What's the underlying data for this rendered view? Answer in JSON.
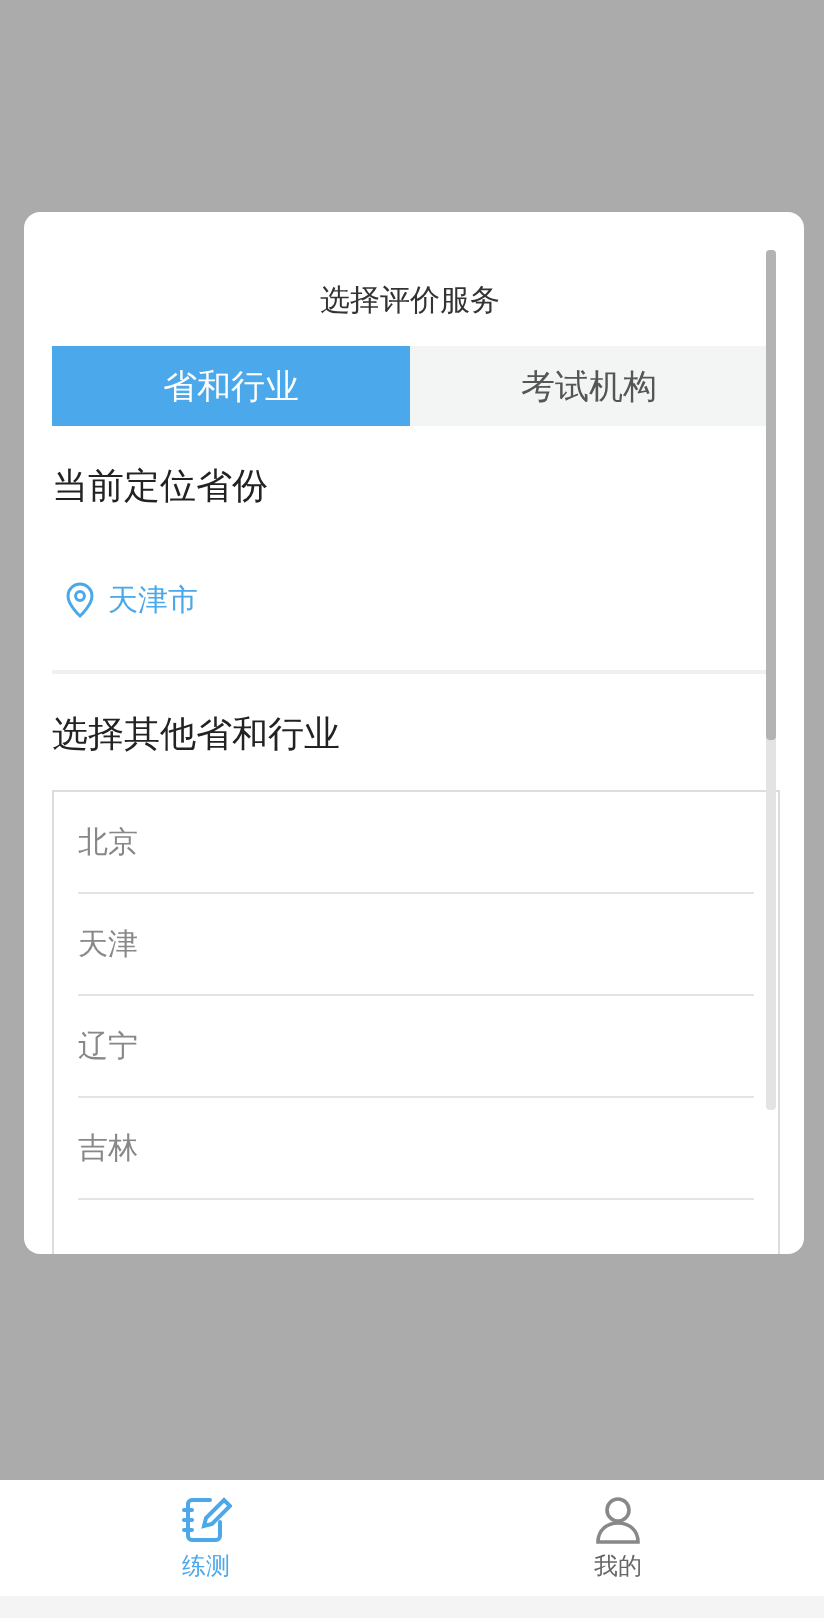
{
  "dialog": {
    "title": "选择评价服务",
    "tabs": [
      {
        "label": "省和行业",
        "selected": true
      },
      {
        "label": "考试机构",
        "selected": false
      }
    ],
    "current_section": {
      "heading": "当前定位省份",
      "location": "天津市"
    },
    "other_section": {
      "heading": "选择其他省和行业",
      "items": [
        "北京",
        "天津",
        "辽宁",
        "吉林"
      ]
    }
  },
  "bottom_nav": [
    {
      "label": "练测",
      "kind": "notebook",
      "selected": true
    },
    {
      "label": "我的",
      "kind": "person",
      "selected": false
    }
  ]
}
